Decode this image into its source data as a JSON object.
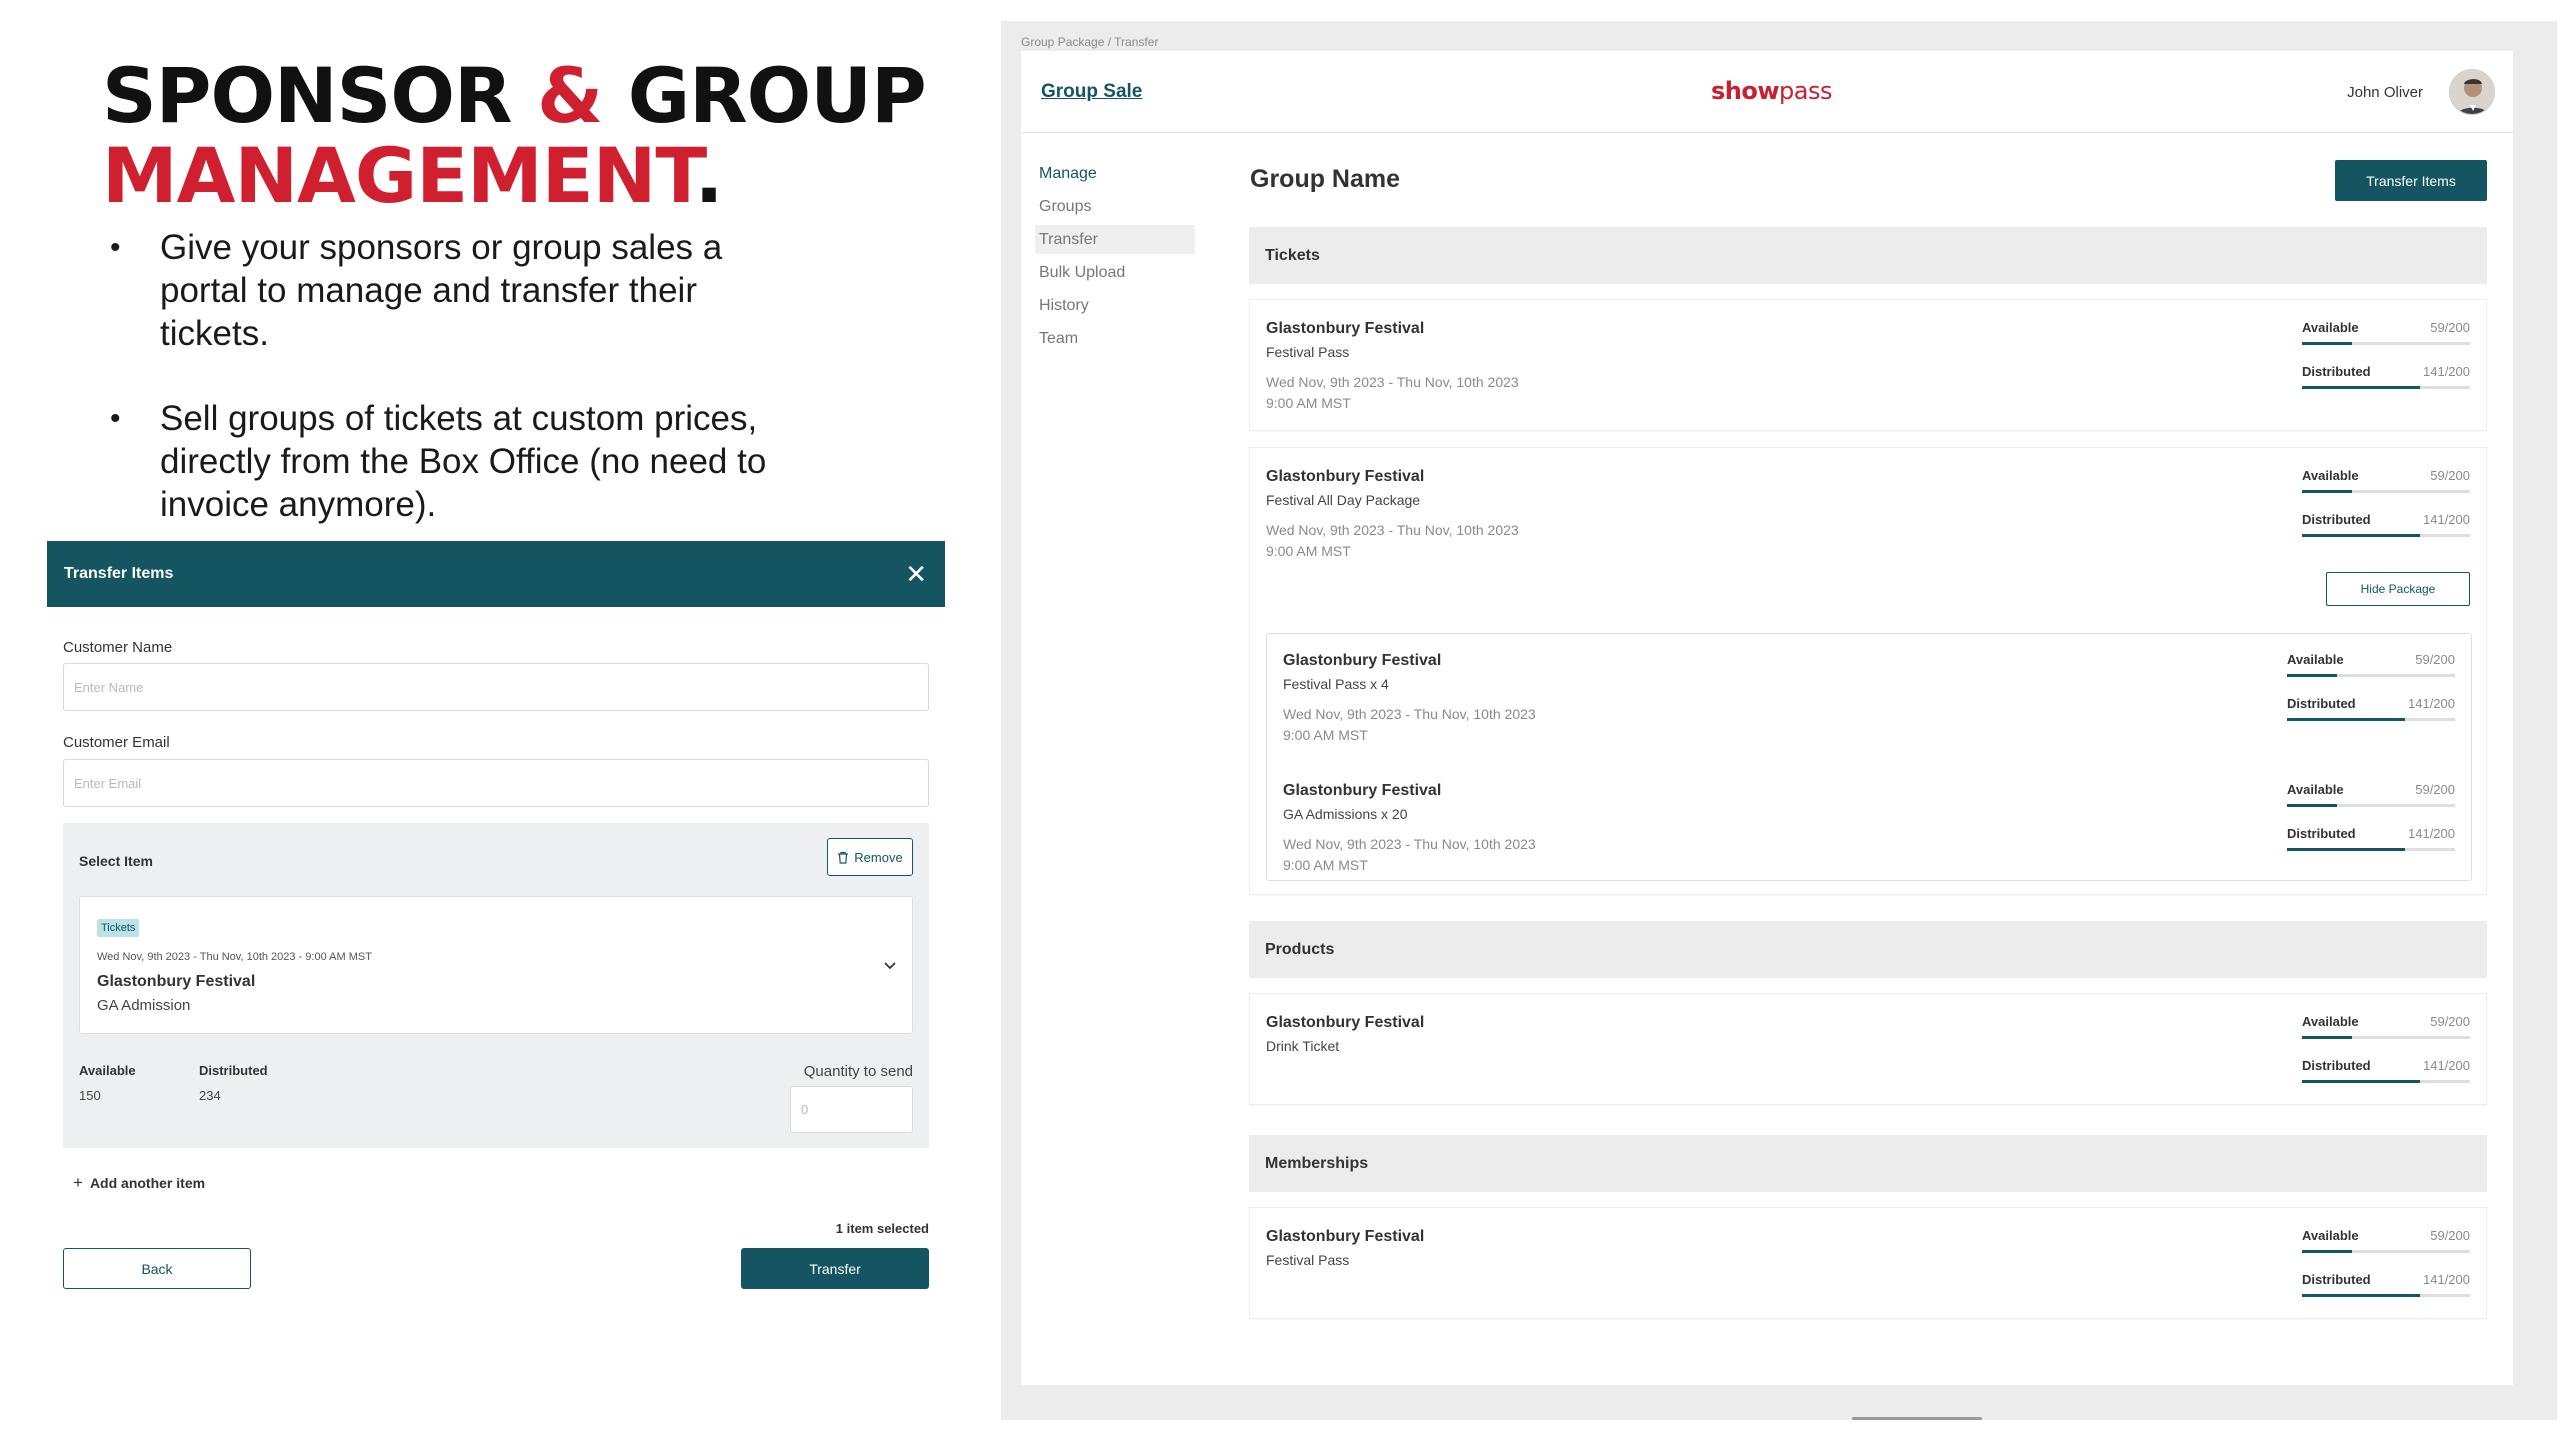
{
  "headline": {
    "line1_a": "SPONSOR ",
    "line1_amp": "&",
    "line1_b": " GROUP",
    "line2": "MANAGEMENT",
    "line2_dot": "."
  },
  "bullets": [
    "Give your sponsors or group sales a portal to manage and transfer their tickets.",
    "Sell groups of tickets at custom prices, directly from the Box Office (no need to invoice anymore)."
  ],
  "modal": {
    "title": "Transfer Items",
    "close_icon": "close-icon",
    "customer_name_label": "Customer Name",
    "customer_name_placeholder": "Enter Name",
    "customer_email_label": "Customer Email",
    "customer_email_placeholder": "Enter Email",
    "select_item_label": "Select Item",
    "remove_label": "Remove",
    "item": {
      "tag": "Tickets",
      "date": "Wed Nov, 9th 2023  -  Thu Nov, 10th 2023  - 9:00 AM MST",
      "name": "Glastonbury Festival",
      "sub": "GA Admission"
    },
    "available_label": "Available",
    "available_value": "150",
    "distributed_label": "Distributed",
    "distributed_value": "234",
    "qty_label": "Quantity to send",
    "qty_placeholder": "0",
    "add_another": "Add another item",
    "selected_count": "1 item selected",
    "back_label": "Back",
    "transfer_label": "Transfer"
  },
  "app": {
    "breadcrumb": "Group Package / Transfer",
    "title": "Group Sale",
    "logo_bold": "show",
    "logo_light": "pass",
    "user_name": "John Oliver",
    "nav": [
      "Manage",
      "Groups",
      "Transfer",
      "Bulk Upload",
      "History",
      "Team"
    ],
    "page_title": "Group Name",
    "transfer_items_label": "Transfer Items",
    "hide_package_label": "Hide Package",
    "sections": {
      "tickets": "Tickets",
      "products": "Products",
      "memberships": "Memberships"
    },
    "metric_labels": {
      "available": "Available",
      "distributed": "Distributed"
    },
    "events": [
      {
        "name": "Glastonbury Festival",
        "sub": "Festival Pass",
        "date": "Wed Nov, 9th 2023   -   Thu Nov, 10th 2023",
        "time": "9:00 AM MST",
        "available": "59/200",
        "available_pct": 29.5,
        "distributed": "141/200",
        "distributed_pct": 70.5
      },
      {
        "name": "Glastonbury Festival",
        "sub": "Festival All Day Package",
        "date": "Wed Nov, 9th 2023   -   Thu Nov, 10th 2023",
        "time": "9:00 AM MST",
        "available": "59/200",
        "available_pct": 29.5,
        "distributed": "141/200",
        "distributed_pct": 70.5
      }
    ],
    "package_items": [
      {
        "name": "Glastonbury Festival",
        "sub": "Festival Pass x 4",
        "date": "Wed Nov, 9th 2023   -   Thu Nov, 10th 2023",
        "time": "9:00 AM MST",
        "available": "59/200",
        "available_pct": 29.5,
        "distributed": "141/200",
        "distributed_pct": 70.5
      },
      {
        "name": "Glastonbury Festival",
        "sub": "GA Admissions x 20",
        "date": "Wed Nov, 9th 2023   -   Thu Nov, 10th 2023",
        "time": "9:00 AM MST",
        "available": "59/200",
        "available_pct": 29.5,
        "distributed": "141/200",
        "distributed_pct": 70.5
      }
    ],
    "products": [
      {
        "name": "Glastonbury Festival",
        "sub": "Drink Ticket",
        "available": "59/200",
        "available_pct": 29.5,
        "distributed": "141/200",
        "distributed_pct": 70.5
      }
    ],
    "memberships": [
      {
        "name": "Glastonbury Festival",
        "sub": "Festival Pass",
        "available": "59/200",
        "available_pct": 29.5,
        "distributed": "141/200",
        "distributed_pct": 70.5
      }
    ]
  },
  "colors": {
    "brand_teal": "#145561",
    "accent_red": "#d0202f",
    "tag_bg": "#b9e3e6",
    "section_bg": "#ececed"
  }
}
